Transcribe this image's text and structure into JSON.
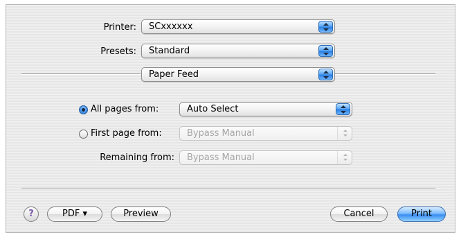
{
  "printer": {
    "label": "Printer:",
    "value": "SCxxxxxx"
  },
  "presets": {
    "label": "Presets:",
    "value": "Standard"
  },
  "panel": {
    "value": "Paper Feed"
  },
  "feed": {
    "all_pages": {
      "label": "All pages from:",
      "value": "Auto Select",
      "selected": true
    },
    "first_page": {
      "label": "First page from:",
      "value": "Bypass Manual",
      "selected": false
    },
    "remaining": {
      "label": "Remaining from:",
      "value": "Bypass Manual"
    }
  },
  "footer": {
    "help": "?",
    "pdf": "PDF ▾",
    "preview": "Preview",
    "cancel": "Cancel",
    "print": "Print"
  },
  "colors": {
    "accent": "#3a8df0",
    "disabled_text": "#a6a6a6"
  }
}
